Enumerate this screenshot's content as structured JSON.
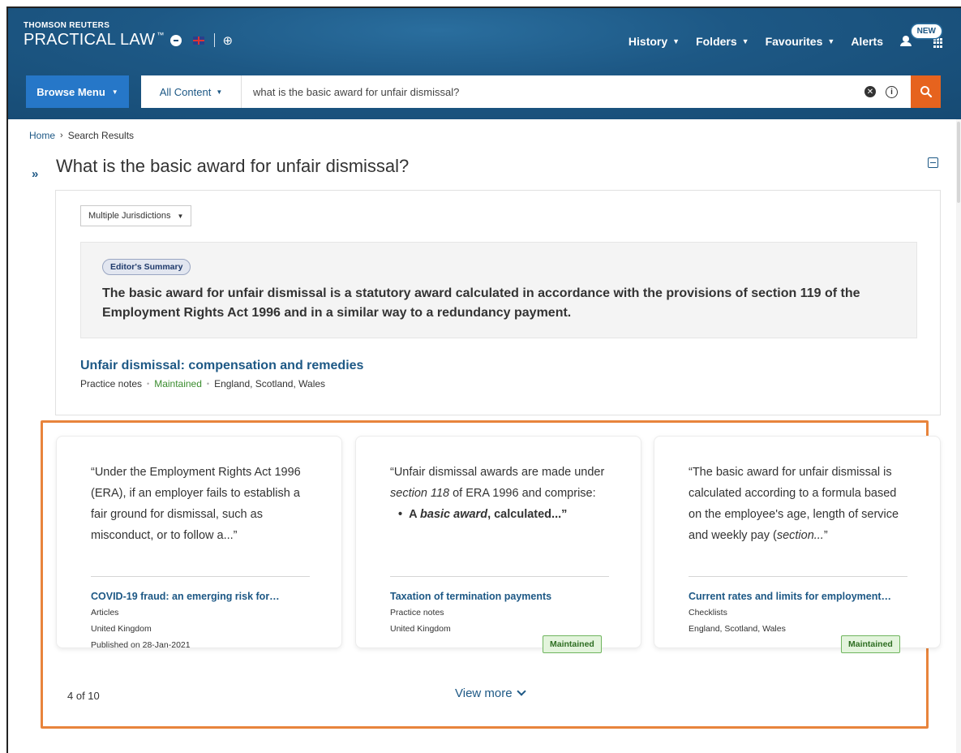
{
  "header": {
    "brand_top": "THOMSON REUTERS",
    "brand_main": "PRACTICAL LAW",
    "brand_tm": "™",
    "nav": [
      {
        "label": "History"
      },
      {
        "label": "Folders"
      },
      {
        "label": "Favourites"
      },
      {
        "label": "Alerts"
      }
    ],
    "new_badge": "NEW"
  },
  "search": {
    "browse_label": "Browse Menu",
    "content_label": "All Content",
    "query": "what is the basic award for unfair dismissal?"
  },
  "breadcrumb": {
    "home": "Home",
    "current": "Search Results"
  },
  "page": {
    "title": "What is the basic award for unfair dismissal?"
  },
  "summary": {
    "jurisdiction": "Multiple Jurisdictions",
    "badge": "Editor's Summary",
    "text": "The basic award for unfair dismissal is a statutory award calculated in accordance with the provisions of section 119 of the Employment Rights Act 1996 and in a similar way to a redundancy payment.",
    "result_title": "Unfair dismissal: compensation and remedies",
    "result_type": "Practice notes",
    "result_status": "Maintained",
    "result_juris": "England, Scotland, Wales"
  },
  "cards": [
    {
      "quote": "“Under the Employment Rights Act 1996 (ERA), if an employer fails to establish a fair ground for dismissal, such as misconduct, or to follow a...”",
      "title": "COVID-19 fraud: an emerging risk for…",
      "type": "Articles",
      "juris": "United Kingdom",
      "published": "Published on 28-Jan-2021"
    },
    {
      "quote_a": "“Unfair dismissal awards are made under ",
      "quote_b": "section 118",
      "quote_c": " of ERA 1996 and comprise:",
      "bullet_a": "A ",
      "bullet_b": "basic award",
      "bullet_c": ", calculated...”",
      "title": "Taxation of termination payments",
      "type": "Practice notes",
      "juris": "United Kingdom",
      "badge": "Maintained"
    },
    {
      "quote_a": "“The basic award for unfair dismissal is calculated according to a formula based on the employee's age, length of service and weekly pay (",
      "quote_b": "section...",
      "quote_c": "”",
      "title": "Current rates and limits for employment…",
      "type": "Checklists",
      "juris": "England, Scotland, Wales",
      "badge": "Maintained"
    }
  ],
  "footer": {
    "count": "4 of 10",
    "view_more": "View more"
  },
  "colors": {
    "header": "#1d5885",
    "accent": "#e6631e",
    "link": "#1d5885",
    "highlight": "#e8843c",
    "maintained": "#3b8d2f"
  }
}
